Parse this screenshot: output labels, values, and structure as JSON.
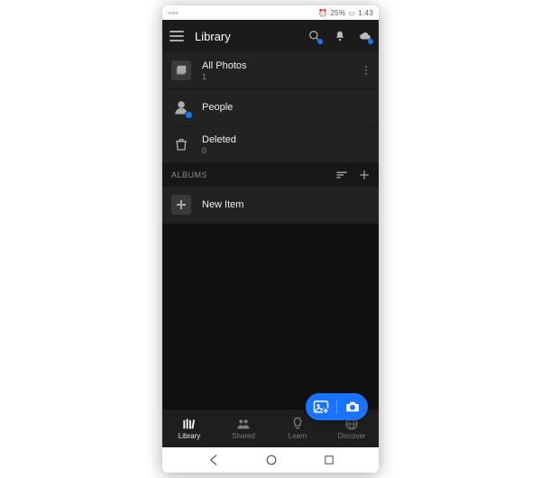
{
  "statusbar": {
    "battery": "25%",
    "time": "1:43"
  },
  "header": {
    "title": "Library"
  },
  "library": {
    "items": [
      {
        "label": "All Photos",
        "count": "1"
      },
      {
        "label": "People"
      },
      {
        "label": "Deleted",
        "count": "0"
      }
    ]
  },
  "albums": {
    "header": "ALBUMS",
    "items": [
      {
        "label": "New Item"
      }
    ]
  },
  "nav": [
    {
      "label": "Library",
      "active": true
    },
    {
      "label": "Shared"
    },
    {
      "label": "Learn"
    },
    {
      "label": "Discover"
    }
  ]
}
